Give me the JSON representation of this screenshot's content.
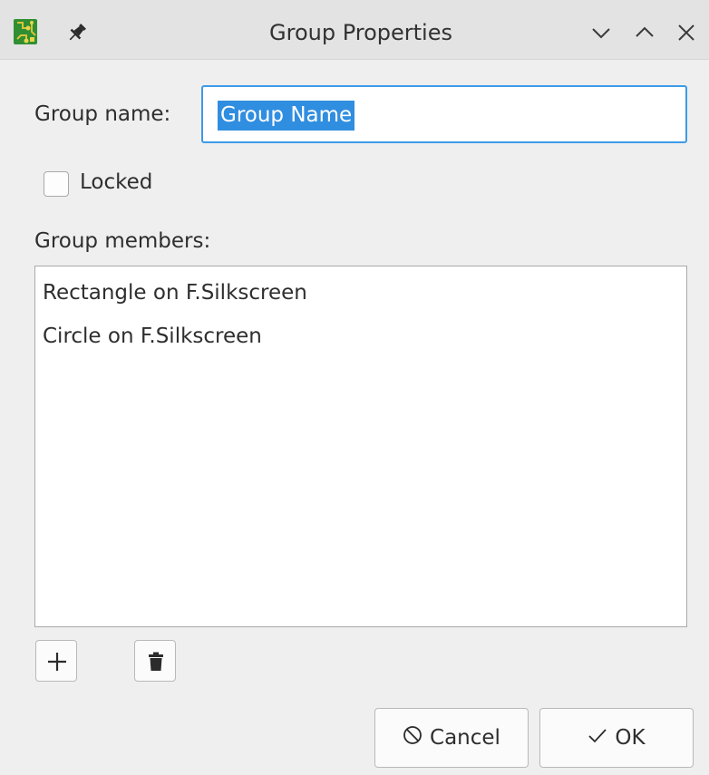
{
  "window": {
    "title": "Group Properties",
    "app_icon": "pcb-app-icon",
    "pin_icon": "pin-icon",
    "controls": [
      "minimize-chevron-icon",
      "maximize-chevron-icon",
      "close-icon"
    ]
  },
  "form": {
    "group_name_label": "Group name:",
    "group_name_value": "Group Name",
    "locked_label": "Locked",
    "locked_checked": false,
    "members_label": "Group members:",
    "members": [
      "Rectangle on F.Silkscreen",
      "Circle on F.Silkscreen"
    ]
  },
  "toolbar": {
    "add_icon": "plus-icon",
    "delete_icon": "trash-icon"
  },
  "buttons": {
    "cancel_label": "Cancel",
    "cancel_icon": "cancel-circle-icon",
    "ok_label": "OK",
    "ok_icon": "checkmark-icon"
  },
  "colors": {
    "accent": "#308ee0",
    "focus_border": "#3d9ae8",
    "background": "#efefef",
    "titlebar": "#e3e3e3",
    "app_icon_green": "#2f8f32"
  }
}
